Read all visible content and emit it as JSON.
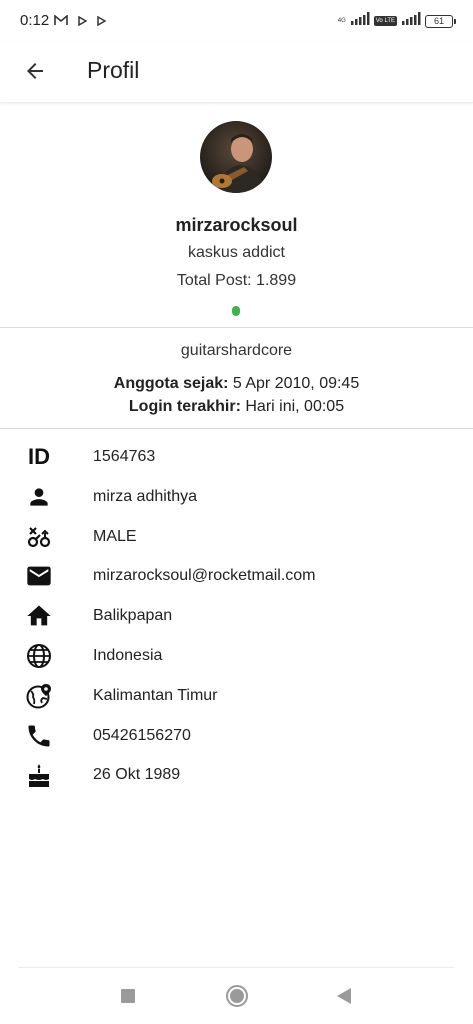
{
  "status_bar": {
    "time": "0:12",
    "network_label": "4G",
    "volte_label": "Vo LTE",
    "battery": "61"
  },
  "app_bar": {
    "title": "Profil"
  },
  "profile": {
    "username": "mirzarocksoul",
    "rank": "kaskus addict",
    "total_post": "Total Post: 1.899",
    "online_color": "#3cb44a",
    "signature": "guitarshardcore",
    "member_since_label": "Anggota sejak:",
    "member_since_value": " 5 Apr 2010, 09:45",
    "last_login_label": "Login terakhir:",
    "last_login_value": " Hari ini, 00:05"
  },
  "info": {
    "id_icon_label": "ID",
    "id": "1564763",
    "full_name": "mirza adhithya",
    "gender": "MALE",
    "email": "mirzarocksoul@rocketmail.com",
    "city": "Balikpapan",
    "country": "Indonesia",
    "province": "Kalimantan Timur",
    "phone": "05426156270",
    "birthday": "26 Okt 1989"
  },
  "icons": {
    "back": "arrow-left-icon",
    "person": "person-icon",
    "gender": "gender-icon",
    "email": "mail-icon",
    "home": "home-icon",
    "globe": "globe-icon",
    "location_globe": "globe-pin-icon",
    "phone": "phone-icon",
    "cake": "cake-icon"
  }
}
